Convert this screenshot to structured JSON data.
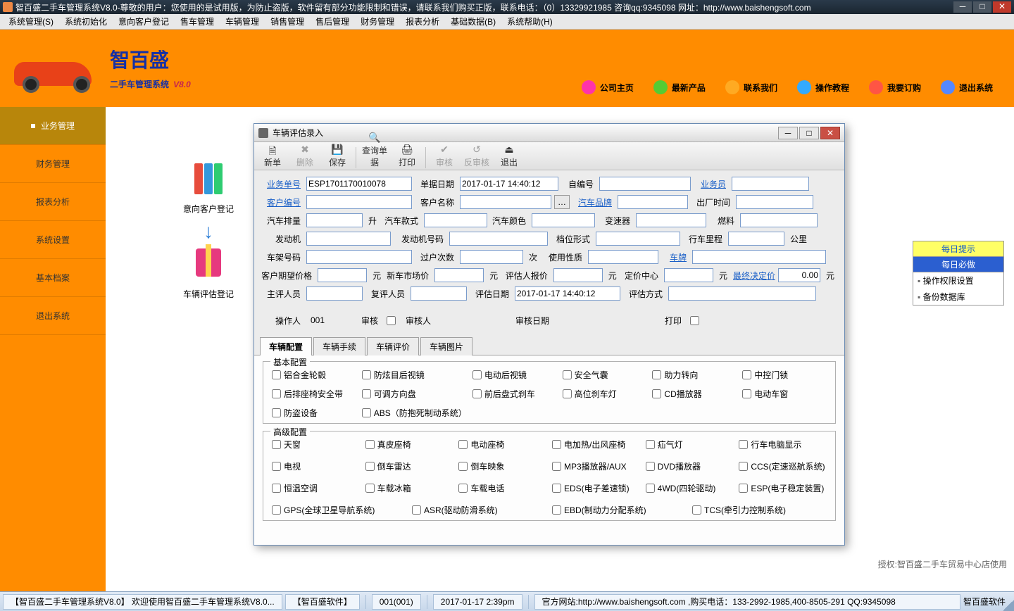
{
  "titlebar": "智百盛二手车管理系统V8.0-尊敬的用户：您使用的是试用版，为防止盗版，软件留有部分功能限制和错误，请联系我们购买正版，联系电话：（0）13329921985 咨询qq:9345098   网址：http://www.baishengsoft.com",
  "menubar": [
    "系统管理(S)",
    "系统初始化",
    "意向客户登记",
    "售车管理",
    "车辆管理",
    "销售管理",
    "售后管理",
    "财务管理",
    "报表分析",
    "基础数据(B)",
    "系统帮助(H)"
  ],
  "logo": {
    "line1": "智百盛",
    "line2": "二手车管理系统",
    "ver": "V8.0"
  },
  "headerNav": [
    "公司主页",
    "最新产品",
    "联系我们",
    "操作教程",
    "我要订购",
    "退出系统"
  ],
  "navColors": [
    "#ff33aa",
    "#55cc33",
    "#ffaa22",
    "#33aaff",
    "#ff5544",
    "#5588ff"
  ],
  "sidebar": {
    "items": [
      "业务管理",
      "财务管理",
      "报表分析",
      "系统设置",
      "基本档案",
      "退出系统"
    ],
    "active": 0
  },
  "workflow": {
    "step1": "意向客户登记",
    "step2": "车辆评估登记"
  },
  "dialog": {
    "title": "车辆评估录入",
    "toolbar": [
      {
        "icon": "🗎",
        "label": "新单",
        "d": false
      },
      {
        "icon": "✖",
        "label": "删除",
        "d": true
      },
      {
        "icon": "💾",
        "label": "保存",
        "d": false
      },
      {
        "icon": "🔍",
        "label": "查询单据",
        "d": false
      },
      {
        "icon": "🖨",
        "label": "打印",
        "d": false
      },
      {
        "icon": "✔",
        "label": "审核",
        "d": true
      },
      {
        "icon": "↺",
        "label": "反审核",
        "d": true
      },
      {
        "icon": "⏏",
        "label": "退出",
        "d": false
      }
    ],
    "form": {
      "business_no_label": "业务单号",
      "business_no": "ESP1701170010078",
      "bill_date_label": "单据日期",
      "bill_date": "2017-01-17 14:40:12",
      "self_no_label": "自编号",
      "clerk_label": "业务员",
      "cust_no_label": "客户编号",
      "cust_name_label": "客户名称",
      "brand_label": "汽车品牌",
      "out_time_label": "出厂时间",
      "displacement_label": "汽车排量",
      "displacement_unit": "升",
      "style_label": "汽车款式",
      "color_label": "汽车颜色",
      "gearbox_label": "变速器",
      "fuel_label": "燃料",
      "engine_label": "发动机",
      "engine_no_label": "发动机号码",
      "gear_type_label": "档位形式",
      "mileage_label": "行车里程",
      "mileage_unit": "公里",
      "vin_label": "车架号码",
      "transfer_label": "过户次数",
      "transfer_unit": "次",
      "usage_label": "使用性质",
      "plate_label": "车牌",
      "expect_price_label": "客户期望价格",
      "yuan": "元",
      "market_price_label": "新车市场价",
      "appraiser_offer_label": "评估人报价",
      "pricing_center_label": "定价中心",
      "final_price_label": "最终决定价",
      "final_price": "0.00",
      "main_appraiser_label": "主评人员",
      "re_appraiser_label": "复评人员",
      "appraise_date_label": "评估日期",
      "appraise_date": "2017-01-17 14:40:12",
      "appraise_method_label": "评估方式",
      "operator_label": "操作人",
      "operator": "001",
      "audit_label": "审核",
      "auditor_label": "审核人",
      "audit_date_label": "审核日期",
      "print_label": "打印"
    },
    "tabs": [
      "车辆配置",
      "车辆手续",
      "车辆评价",
      "车辆图片"
    ],
    "basic_title": "基本配置",
    "basic": [
      "铝合金轮毂",
      "防炫目后视镜",
      "电动后视镜",
      "安全气囊",
      "助力转向",
      "中控门锁",
      "后排座椅安全带",
      "可调方向盘",
      "前后盘式刹车",
      "高位刹车灯",
      "CD播放器",
      "电动车窗",
      "防盗设备",
      "ABS（防抱死制动系统）"
    ],
    "adv_title": "高级配置",
    "adv_row1": [
      "天窗",
      "真皮座椅",
      "电动座椅",
      "电加热/出风座椅",
      "疝气灯",
      "行车电脑显示"
    ],
    "adv_row2": [
      "电视",
      "倒车雷达",
      "倒车映象",
      "MP3播放器/AUX",
      "DVD播放器",
      "CCS(定速巡航系统)"
    ],
    "adv_row3": [
      "恒温空调",
      "车载冰箱",
      "车载电话",
      "EDS(电子差速锁)",
      "4WD(四轮驱动)",
      "ESP(电子稳定装置)"
    ],
    "adv_row4": [
      "GPS(全球卫星导航系统)",
      "ASR(驱动防滑系统)",
      "EBD(制动力分配系统)",
      "TCS(牵引力控制系统)"
    ]
  },
  "rightPanel": {
    "title": "每日提示",
    "sub": "每日必做",
    "items": [
      "操作权限设置",
      "备份数据库"
    ]
  },
  "authText": "授权:智百盛二手车贸易中心店使用",
  "taskbar": {
    "t1": "【智百盛二手车管理系统V8.0】 欢迎使用智百盛二手车管理系统V8.0...",
    "t2": "【智百盛软件】",
    "t3": "001(001)",
    "t4": "2017-01-17 2:39pm",
    "t5": "官方网站:http://www.baishengsoft.com ,购买电话：133-2992-1985,400-8505-291 QQ:9345098",
    "right": "智百盛软件"
  }
}
